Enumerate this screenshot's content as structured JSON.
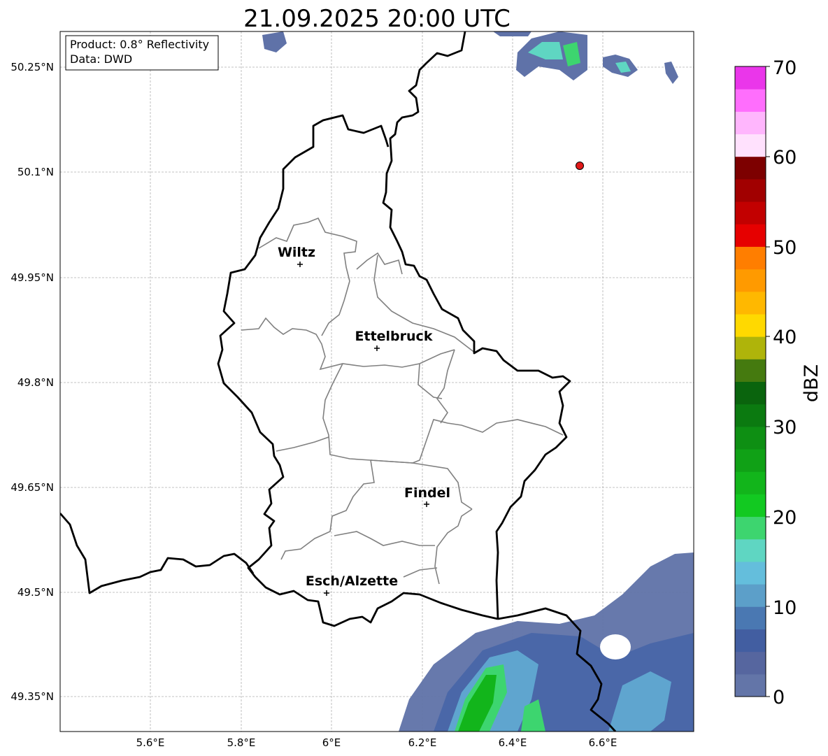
{
  "title": "21.09.2025 20:00 UTC",
  "info_box": {
    "product": "Product: 0.8° Reflectivity",
    "source": "Data: DWD"
  },
  "lon_ticks": [
    "5.6°E",
    "5.8°E",
    "6°E",
    "6.2°E",
    "6.4°E",
    "6.6°E"
  ],
  "lat_ticks": [
    "50.25°N",
    "50.1°N",
    "49.95°N",
    "49.8°N",
    "49.65°N",
    "49.5°N",
    "49.35°N"
  ],
  "cities": [
    {
      "name": "Wiltz"
    },
    {
      "name": "Ettelbruck"
    },
    {
      "name": "Findel"
    },
    {
      "name": "Esch/Alzette"
    }
  ],
  "colorbar": {
    "label": "dBZ",
    "ticks": [
      "0",
      "10",
      "20",
      "30",
      "40",
      "50",
      "60",
      "70"
    ],
    "colors": [
      "#6375a8",
      "#56669f",
      "#425ea1",
      "#4a78b2",
      "#5c9fc9",
      "#64bedc",
      "#5fd6c2",
      "#3dd56f",
      "#12c921",
      "#12b51b",
      "#10a116",
      "#0e8f13",
      "#0b7a10",
      "#0a640d",
      "#457a0f",
      "#afb40a",
      "#ffd900",
      "#ffb800",
      "#ff9a00",
      "#ff7e00",
      "#e60000",
      "#c20000",
      "#a10000",
      "#7d0000",
      "#ffe1fd",
      "#ffb6fd",
      "#ff6efd",
      "#ea36ea"
    ]
  },
  "marker_color": "#e11919"
}
